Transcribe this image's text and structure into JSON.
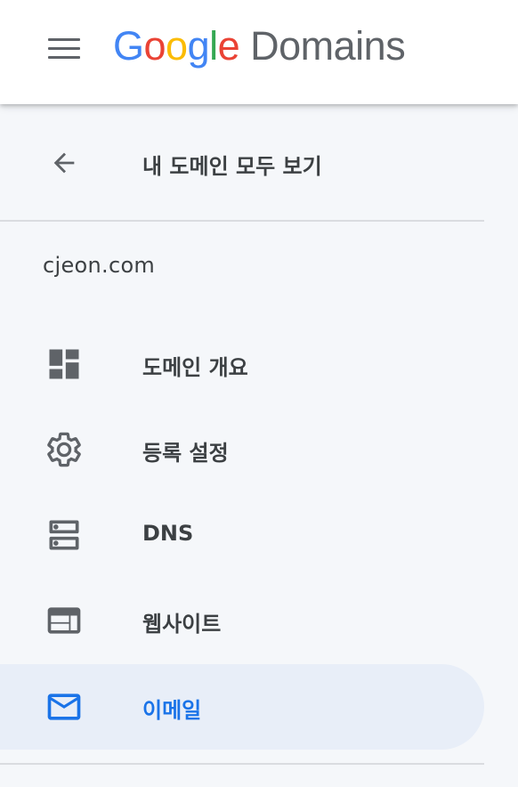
{
  "header": {
    "menu_icon": "hamburger-menu-icon",
    "logo": {
      "letters": [
        {
          "char": "G",
          "color": "#4285F4"
        },
        {
          "char": "o",
          "color": "#EA4335"
        },
        {
          "char": "o",
          "color": "#FBBC05"
        },
        {
          "char": "g",
          "color": "#4285F4"
        },
        {
          "char": "l",
          "color": "#34A853"
        },
        {
          "char": "e",
          "color": "#EA4335"
        }
      ],
      "product": "Domains"
    }
  },
  "back": {
    "label": "내 도메인 모두 보기",
    "icon": "arrow-back-icon"
  },
  "domain": {
    "name": "cjeon.com"
  },
  "nav": {
    "items": [
      {
        "label": "도메인 개요",
        "icon": "dashboard-icon",
        "active": false
      },
      {
        "label": "등록 설정",
        "icon": "gear-icon",
        "active": false
      },
      {
        "label": "DNS",
        "icon": "dns-icon",
        "active": false
      },
      {
        "label": "웹사이트",
        "icon": "web-icon",
        "active": false
      },
      {
        "label": "이메일",
        "icon": "mail-icon",
        "active": true
      }
    ]
  },
  "colors": {
    "accent": "#1a73e8",
    "active_bg": "#e8eef8",
    "icon_gray": "#5f6368",
    "text": "#3c4043",
    "sidebar_bg": "#f5f7fa"
  }
}
